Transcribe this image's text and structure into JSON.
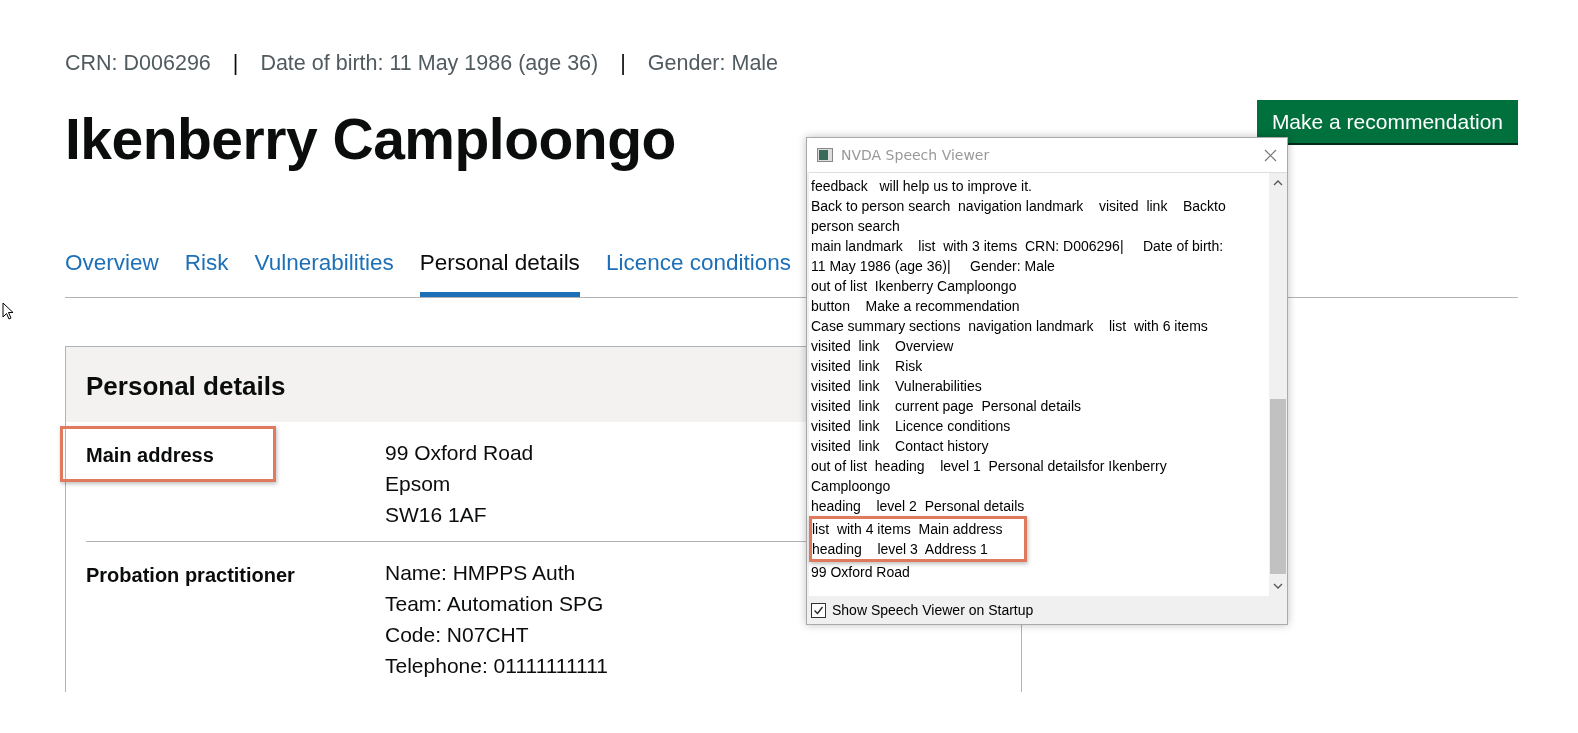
{
  "meta": [
    {
      "kind": "value",
      "text": "CRN: D006296"
    },
    {
      "kind": "separator",
      "text": "|"
    },
    {
      "kind": "value",
      "text": "Date of birth: 11 May 1986 (age 36)"
    },
    {
      "kind": "separator",
      "text": "|"
    },
    {
      "kind": "value",
      "text": "Gender: Male"
    }
  ],
  "name": "Ikenberry Camploongo",
  "action_button": "Make a recommendation",
  "tabs": [
    {
      "label": "Overview",
      "selected": false
    },
    {
      "label": "Risk",
      "selected": false
    },
    {
      "label": "Vulnerabilities",
      "selected": false
    },
    {
      "label": "Personal details",
      "selected": true
    },
    {
      "label": "Licence conditions",
      "selected": false
    }
  ],
  "card": {
    "title": "Personal details",
    "rows": [
      {
        "key": "Main address",
        "highlighted": true,
        "lines": [
          "99 Oxford Road",
          "Epsom",
          "SW16 1AF"
        ]
      },
      {
        "key": "Probation practitioner",
        "highlighted": false,
        "lines": [
          "Name: HMPPS Auth",
          "Team: Automation SPG",
          "Code: N07CHT",
          "Telephone: 01111111111"
        ]
      }
    ]
  },
  "speech_viewer": {
    "title": "NVDA Speech Viewer",
    "lines": [
      {
        "text": "feedback   will help us to improve it.",
        "highlighted": false
      },
      {
        "text": "Back to person search  navigation landmark    visited  link    Backto",
        "highlighted": false
      },
      {
        "text": "person search",
        "highlighted": false
      },
      {
        "text": "main landmark    list  with 3 items  CRN: D006296|     Date of birth:",
        "highlighted": false
      },
      {
        "text": "11 May 1986 (age 36)|     Gender: Male",
        "highlighted": false
      },
      {
        "text": "out of list  Ikenberry Camploongo",
        "highlighted": false
      },
      {
        "text": "button    Make a recommendation",
        "highlighted": false
      },
      {
        "text": "Case summary sections  navigation landmark    list  with 6 items",
        "highlighted": false
      },
      {
        "text": "visited  link    Overview",
        "highlighted": false
      },
      {
        "text": "visited  link    Risk",
        "highlighted": false
      },
      {
        "text": "visited  link    Vulnerabilities",
        "highlighted": false
      },
      {
        "text": "visited  link    current page  Personal details",
        "highlighted": false
      },
      {
        "text": "visited  link    Licence conditions",
        "highlighted": false
      },
      {
        "text": "visited  link    Contact history",
        "highlighted": false
      },
      {
        "text": "out of list  heading    level 1  Personal detailsfor Ikenberry",
        "highlighted": false
      },
      {
        "text": "Camploongo",
        "highlighted": false
      },
      {
        "text": "heading    level 2  Personal details",
        "highlighted": false
      },
      {
        "text": "list  with 4 items  Main address",
        "highlighted": true
      },
      {
        "text": "heading    level 3  Address 1",
        "highlighted": true
      },
      {
        "text": "99 Oxford Road",
        "highlighted": false
      }
    ],
    "startup_option": {
      "label": "Show Speech Viewer on Startup",
      "checked": true
    }
  }
}
